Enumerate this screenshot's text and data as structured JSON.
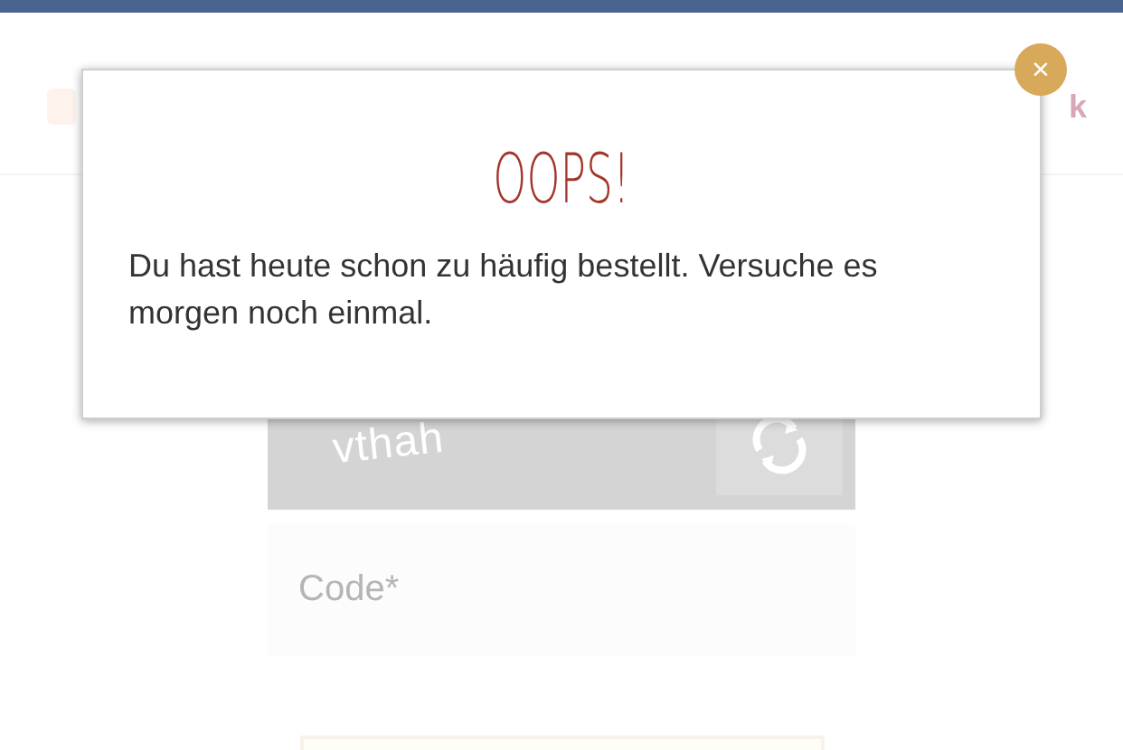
{
  "header": {
    "link_fragment": "k"
  },
  "captcha": {
    "text": "vthah"
  },
  "code_field": {
    "placeholder": "Code*"
  },
  "modal": {
    "title": "OOPS!",
    "message": "Du hast heute schon zu häufig bestellt. Versuche es morgen noch einmal.",
    "close": "×"
  }
}
